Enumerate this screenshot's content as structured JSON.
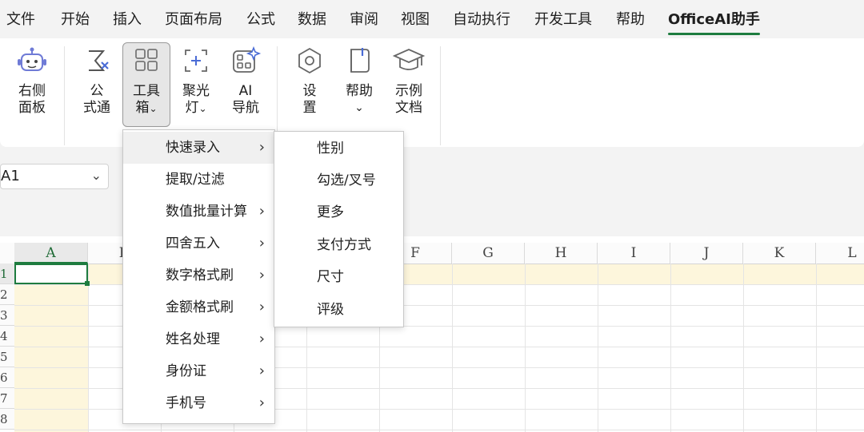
{
  "menubar": {
    "items": [
      "文件",
      "开始",
      "插入",
      "页面布局",
      "公式",
      "数据",
      "审阅",
      "视图",
      "自动执行",
      "开发工具",
      "帮助",
      "OfficeAI助手"
    ]
  },
  "ribbon": {
    "buttons": [
      {
        "line1": "右侧",
        "line2": "面板",
        "icon": "robot-icon"
      },
      {
        "line1": "公",
        "line2": "式通",
        "icon": "sigma-formula-icon"
      },
      {
        "line1": "工具",
        "line2": "箱",
        "icon": "grid-toolbox-icon",
        "chevron": "⌄"
      },
      {
        "line1": "聚光",
        "line2": "灯",
        "icon": "spotlight-crosshair-icon",
        "chevron": "⌄"
      },
      {
        "line1": "AI",
        "line2": "导航",
        "icon": "ai-navigation-icon"
      },
      {
        "line1": "设",
        "line2": "置",
        "icon": "hexagon-settings-icon"
      },
      {
        "line1": "帮助",
        "line2": "⌄",
        "icon": "help-book-icon"
      },
      {
        "line1": "示例",
        "line2": "文档",
        "icon": "graduation-cap-icon"
      }
    ]
  },
  "namebox": {
    "value": "A1",
    "dropdown": "⌄"
  },
  "formula": {
    "dots": "⋮"
  },
  "grid": {
    "columns": [
      "A",
      "B",
      "",
      "",
      "",
      "F",
      "G",
      "H",
      "I",
      "J",
      "K",
      "L"
    ],
    "rows": [
      "1",
      "2",
      "3",
      "4",
      "5",
      "6",
      "7",
      "8"
    ]
  },
  "toolbox_menu": {
    "items": [
      {
        "label": "快速录入",
        "arrow": "›"
      },
      {
        "label": "提取/过滤",
        "arrow": ""
      },
      {
        "label": "数值批量计算",
        "arrow": "›"
      },
      {
        "label": "四舍五入",
        "arrow": "›"
      },
      {
        "label": "数字格式刷",
        "arrow": "›"
      },
      {
        "label": "金额格式刷",
        "arrow": "›"
      },
      {
        "label": "姓名处理",
        "arrow": "›"
      },
      {
        "label": "身份证",
        "arrow": "›"
      },
      {
        "label": "手机号",
        "arrow": "›"
      }
    ]
  },
  "quick_entry_submenu": {
    "items": [
      "性别",
      "勾选/叉号",
      "更多",
      "支付方式",
      "尺寸",
      "评级"
    ]
  },
  "colors": {
    "accent": "#1e7c3f",
    "highlight": "#fdf6dc",
    "chrome": "#f3f3f3"
  }
}
